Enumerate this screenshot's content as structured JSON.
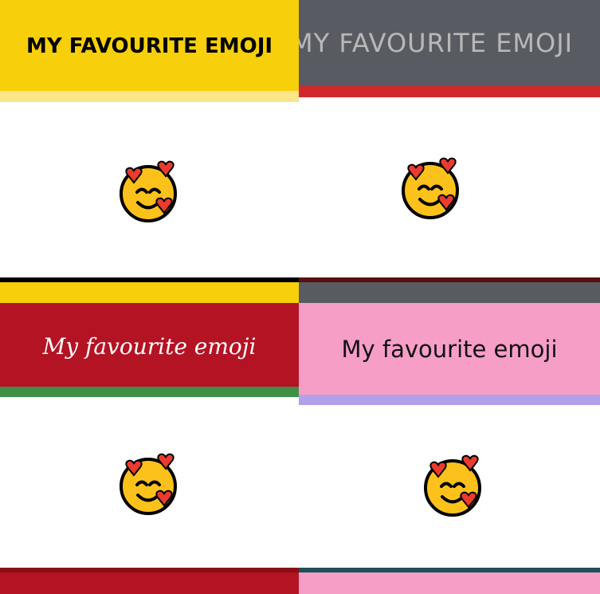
{
  "cards": [
    {
      "title": "MY FAVOURITE EMOJI",
      "colors": {
        "header": "#f7cf0a",
        "text": "#000000",
        "stripe_top": "#fde58a"
      }
    },
    {
      "title": "MY FAVOURITE EMOJI",
      "colors": {
        "header": "#585b61",
        "text": "#b8b8b8",
        "stripe_top": "#d0282c"
      }
    },
    {
      "title": "My favourite emoji",
      "colors": {
        "header": "#b41324",
        "text": "#ffffff",
        "stripe_top": "#3f8f47"
      }
    },
    {
      "title": "My favourite emoji",
      "colors": {
        "header": "#f79ec7",
        "text": "#111111",
        "stripe_top": "#b0a1e8"
      }
    }
  ],
  "emoji_icon": "smiling-face-with-hearts-icon"
}
